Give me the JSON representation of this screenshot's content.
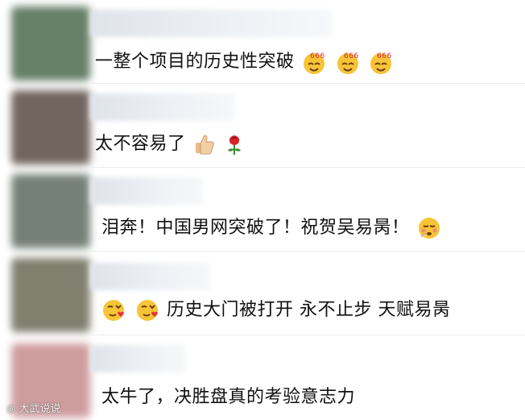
{
  "comments": [
    {
      "text": "一整个项目的历史性突破",
      "avatar_color": "#4c6a4e"
    },
    {
      "text": "太不容易了",
      "avatar_color": "#5a4a44"
    },
    {
      "text": "泪奔！中国男网突破了！祝贺吴易昺！",
      "avatar_color": "#5d6b61"
    },
    {
      "text": "历史大门被打开 永不止步 天赋易昺",
      "avatar_color": "#6a6a57"
    },
    {
      "text": "太牛了，决胜盘真的考验意志力",
      "avatar_color": "#c78b8d"
    }
  ],
  "icons": {
    "comment_1": [
      "smile-666-emoji-icon",
      "smile-666-emoji-icon",
      "smile-666-emoji-icon"
    ],
    "comment_2": [
      "thumbs-up-icon",
      "rose-icon"
    ],
    "comment_3": [
      "blush-emoji-icon"
    ],
    "comment_4_prefix": [
      "heart-kiss-emoji-icon",
      "heart-kiss-emoji-icon"
    ]
  },
  "watermark": "大武说说"
}
